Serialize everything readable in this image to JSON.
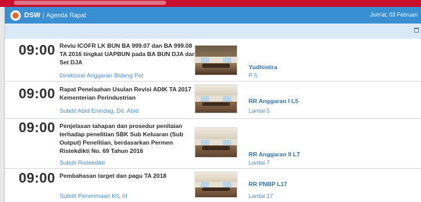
{
  "app": {
    "brand": "DSW",
    "separator": "|",
    "page_name": "Agenda Rapat",
    "date": "Jum'at, 03 Februari"
  },
  "icons": {
    "logo": "dsw-logo-icon",
    "calendar": "calendar-icon"
  },
  "colors": {
    "navbar": "#3a8fd2",
    "subbar": "#d9e9f6",
    "link": "#4a8ac7",
    "top_strip": "#c8102e"
  },
  "agenda": [
    {
      "time": "09:00",
      "title_lines": [
        "Reviu ICOFR LK BUN BA 999.07 dan BA 999.08",
        "TA 2016 tingkat UAPBUN pada BA BUN DJA dan",
        "Set DJA"
      ],
      "unit": "Direktorat Anggaran Bidang Pol",
      "room": "Yudhistira",
      "floor": "P 5"
    },
    {
      "time": "09:00",
      "title_lines": [
        "Rapat Penelaahan Usulan Revisi ADIK TA 2017",
        "Kementerian Perindustrian"
      ],
      "unit": "Subdit Abid Enindag, Dit. Abid",
      "room": "RR Anggaran I L5",
      "floor": "Lantai 5"
    },
    {
      "time": "09:00",
      "title_lines": [
        "Penjelasan tahapan dan prosedur penilaian",
        "terhadap penelitian SBK Sub Keluaran (Sub",
        "Output) Penelitian, berdasarkan Permen",
        "Ristekdikti No. 69 Tahun 2016"
      ],
      "unit": "Subdit Ristekdikti",
      "room": "RR Anggaran II L7",
      "floor": "Lantai 7"
    },
    {
      "time": "09:00",
      "title_lines": [
        "Pembahasan target dan pagu TA 2018"
      ],
      "unit": "Subdit Penerimaan K/L III",
      "room": "RR PNBP L17",
      "floor": "Lantai 17"
    }
  ]
}
